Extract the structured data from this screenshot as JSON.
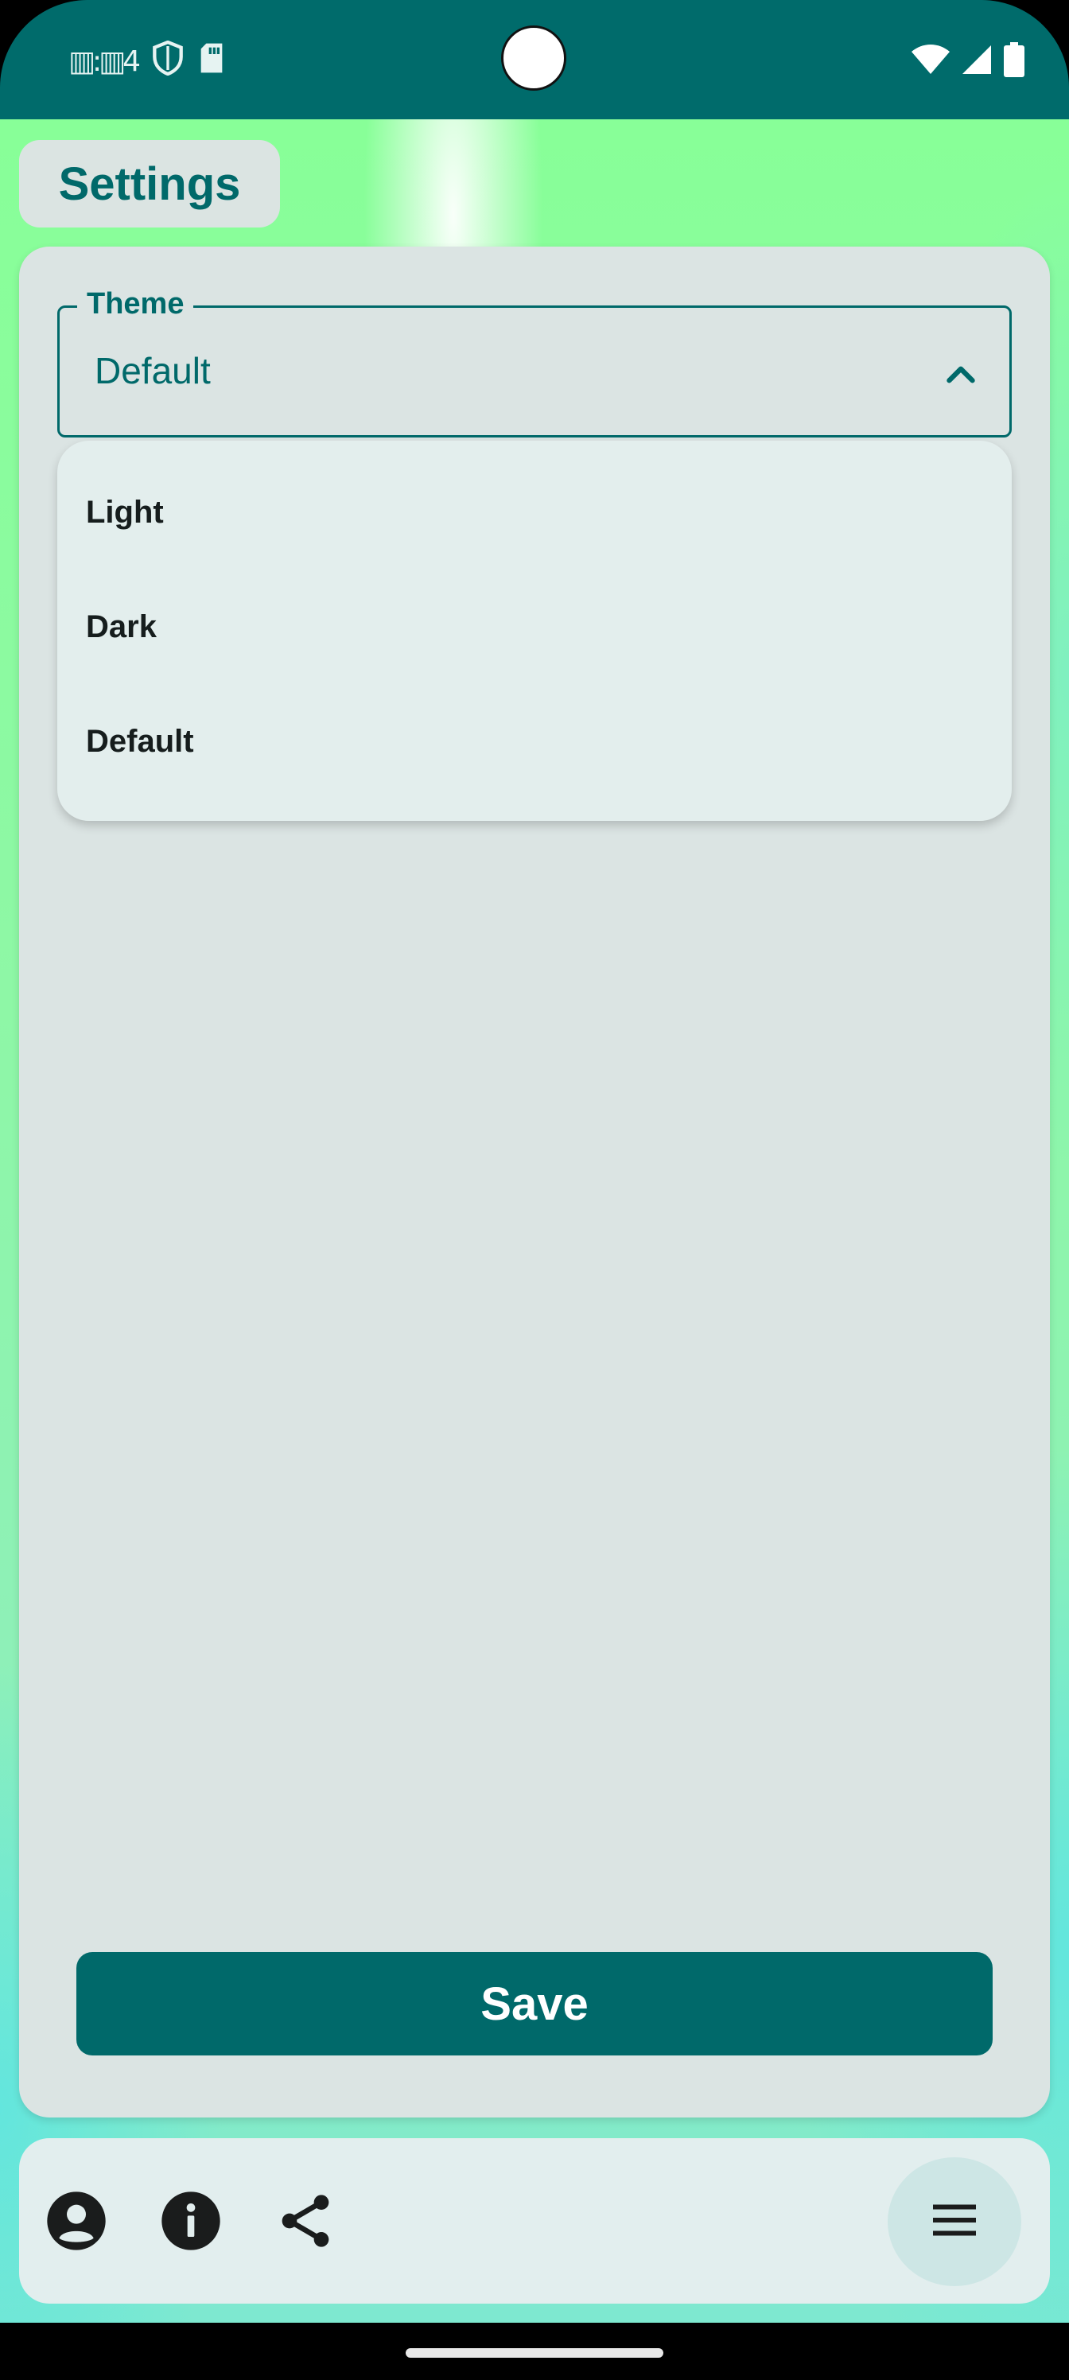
{
  "status_bar": {
    "left_text": "▥:▥4",
    "icons": [
      "shield-icon",
      "sd-card-icon"
    ],
    "right_icons": [
      "wifi-icon",
      "cellular-signal-icon",
      "battery-icon"
    ]
  },
  "header": {
    "title": "Settings"
  },
  "theme_field": {
    "label": "Theme",
    "value": "Default",
    "expanded": true
  },
  "theme_menu": {
    "options": [
      "Light",
      "Dark",
      "Default"
    ]
  },
  "actions": {
    "save_label": "Save"
  },
  "bottom_bar": {
    "icons": [
      "account-icon",
      "info-icon",
      "share-icon"
    ],
    "fab_icon": "menu-icon"
  },
  "colors": {
    "primary": "#00696a",
    "surface": "#dbe4e3",
    "menu_surface": "#e3eeed",
    "background_accent": "#88ff98"
  }
}
